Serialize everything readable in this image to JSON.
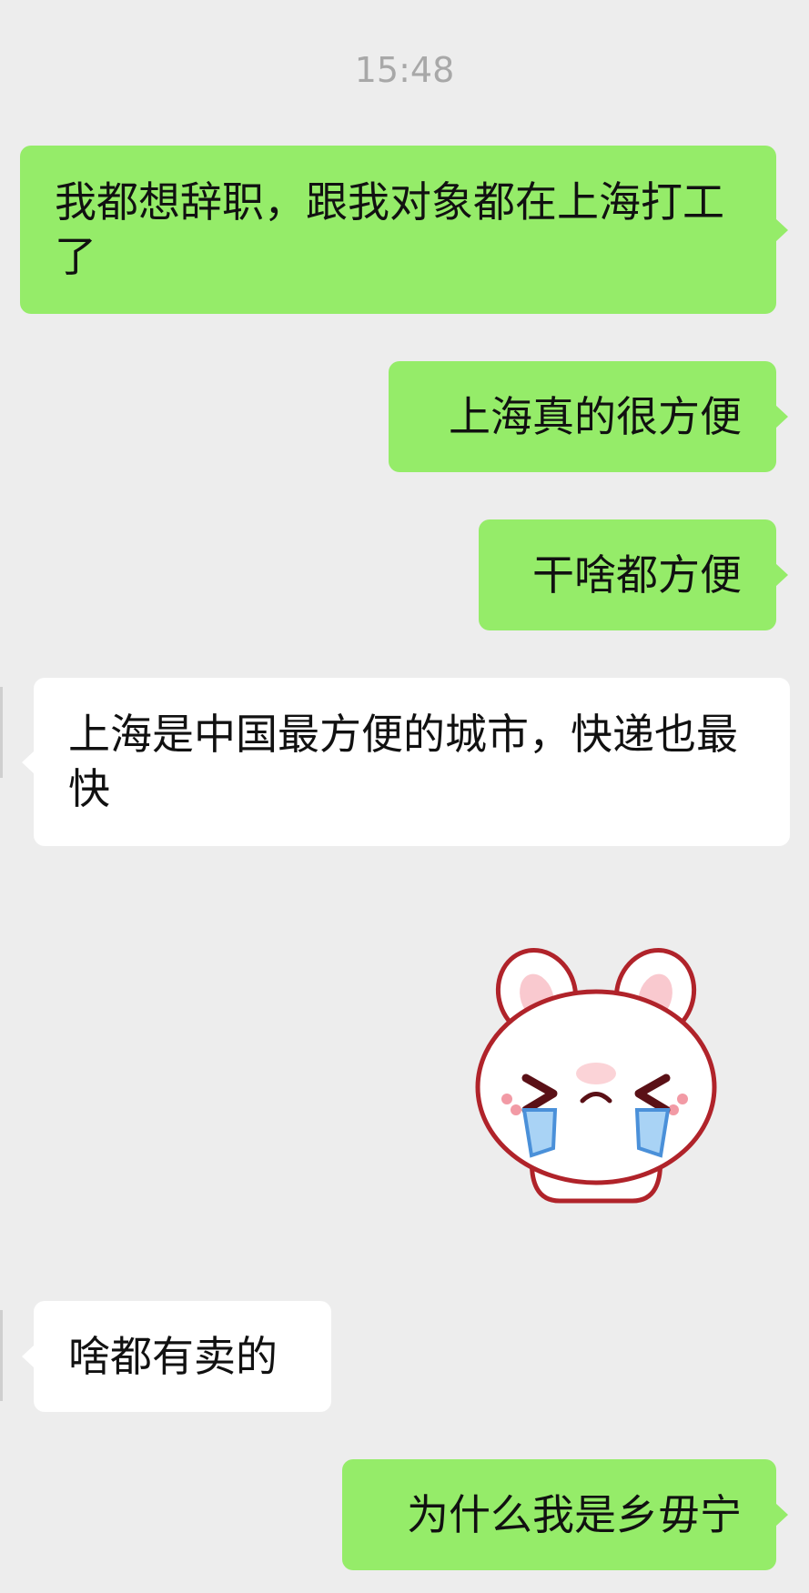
{
  "chat": {
    "timestamp": "15:48",
    "messages": [
      {
        "direction": "outgoing",
        "type": "text",
        "text": "我都想辞职，跟我对象都在上海打工了"
      },
      {
        "direction": "outgoing",
        "type": "text",
        "text": "上海真的很方便"
      },
      {
        "direction": "outgoing",
        "type": "text",
        "text": "干啥都方便"
      },
      {
        "direction": "incoming",
        "type": "text",
        "text": "上海是中国最方便的城市，快递也最快"
      },
      {
        "direction": "outgoing",
        "type": "sticker",
        "sticker": "crying-bunny-icon"
      },
      {
        "direction": "incoming",
        "type": "text",
        "text": "啥都有卖的"
      },
      {
        "direction": "outgoing",
        "type": "text",
        "text": "为什么我是乡毋宁"
      }
    ]
  },
  "colors": {
    "background": "#ededed",
    "outgoing_bubble": "#95ec69",
    "incoming_bubble": "#ffffff",
    "timestamp_text": "#a8a8a8"
  }
}
